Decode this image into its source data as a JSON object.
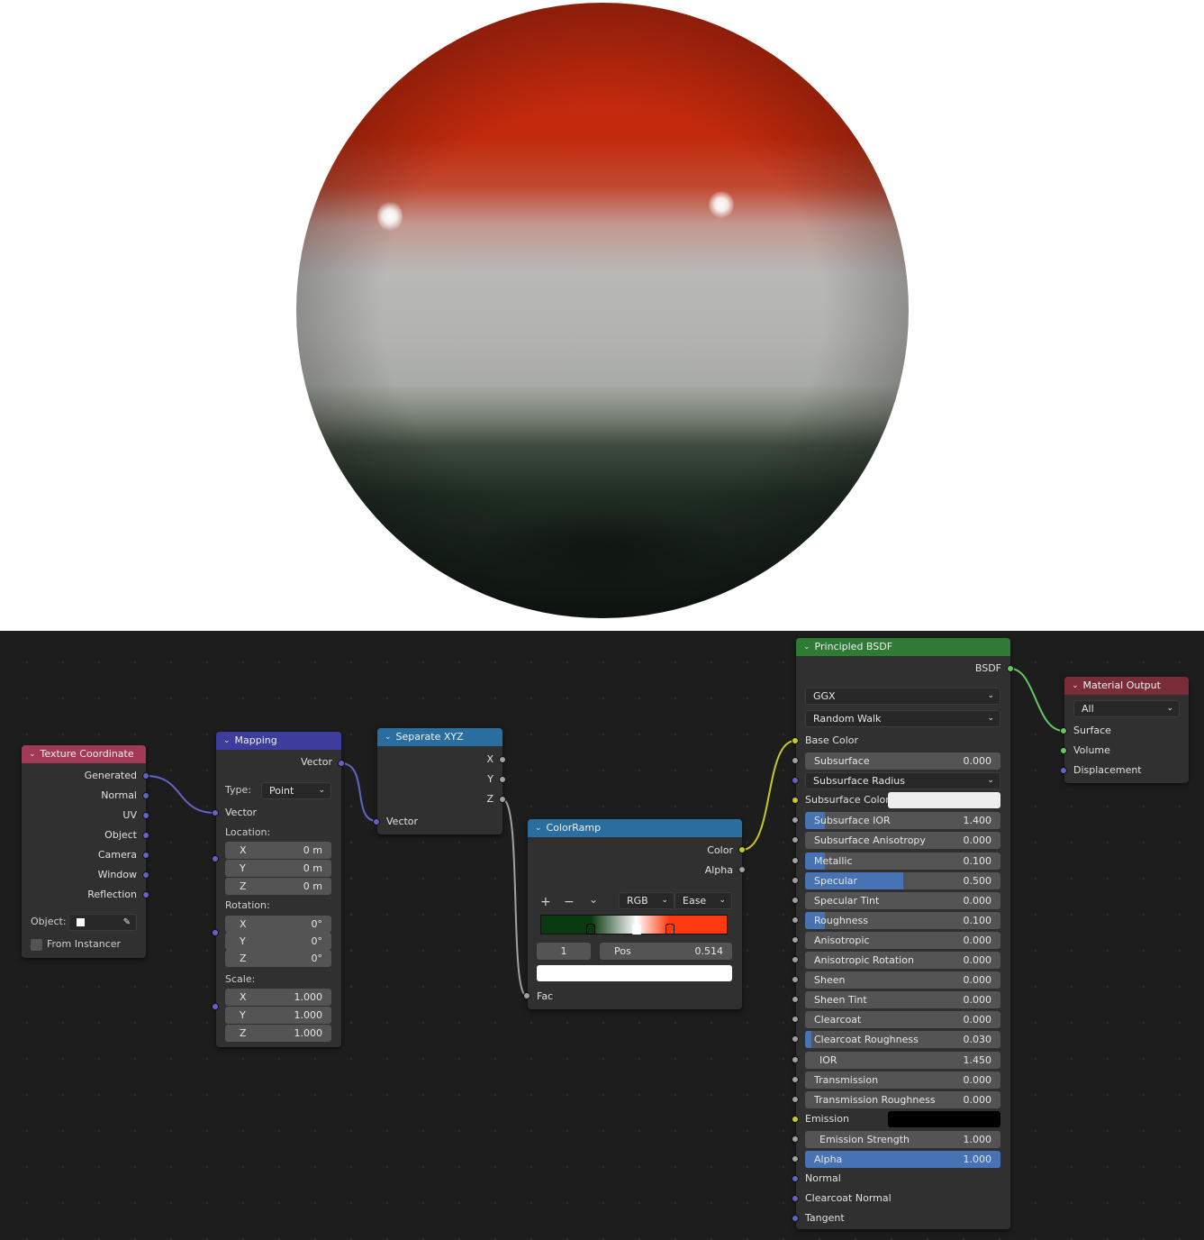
{
  "nodes": {
    "texcoord": {
      "title": "Texture Coordinate",
      "outputs": [
        "Generated",
        "Normal",
        "UV",
        "Object",
        "Camera",
        "Window",
        "Reflection"
      ],
      "object_label": "Object:",
      "from_instancer": "From Instancer",
      "header_color": "#a33a55"
    },
    "mapping": {
      "title": "Mapping",
      "output": "Vector",
      "type_label": "Type:",
      "type_value": "Point",
      "vector_label": "Vector",
      "location_label": "Location:",
      "location": [
        [
          "X",
          "0 m"
        ],
        [
          "Y",
          "0 m"
        ],
        [
          "Z",
          "0 m"
        ]
      ],
      "rotation_label": "Rotation:",
      "rotation": [
        [
          "X",
          "0°"
        ],
        [
          "Y",
          "0°"
        ],
        [
          "Z",
          "0°"
        ]
      ],
      "scale_label": "Scale:",
      "scale": [
        [
          "X",
          "1.000"
        ],
        [
          "Y",
          "1.000"
        ],
        [
          "Z",
          "1.000"
        ]
      ],
      "header_color": "#3d3d9e"
    },
    "separate": {
      "title": "Separate XYZ",
      "outputs": [
        "X",
        "Y",
        "Z"
      ],
      "input": "Vector",
      "header_color": "#2a6ea0"
    },
    "colorramp": {
      "title": "ColorRamp",
      "outputs": [
        "Color",
        "Alpha"
      ],
      "add": "+",
      "remove": "−",
      "menu": "⌄",
      "color_mode": "RGB",
      "interpolation": "Ease",
      "stop_index": "1",
      "pos_label": "Pos",
      "pos_value": "0.514",
      "input": "Fac",
      "stops": [
        0.27,
        0.514,
        0.69
      ],
      "ramp_colors": [
        "#0b3a10",
        "#ffffff",
        "#ff3a0f"
      ],
      "header_color": "#2a6ea0"
    },
    "bsdf": {
      "title": "Principled BSDF",
      "output": "BSDF",
      "distribution": "GGX",
      "subsurface_method": "Random Walk",
      "base_color": "Base Color",
      "rows": [
        {
          "label": "Subsurface",
          "value": "0.000",
          "fill": 0.0
        },
        {
          "label": "Subsurface Radius",
          "value": "",
          "fill": 0.0,
          "dropdown": true
        },
        {
          "label": "Subsurface Color",
          "value": "",
          "fill": 0.0,
          "color": true
        },
        {
          "label": "Subsurface IOR",
          "value": "1.400",
          "fill": 0.1
        },
        {
          "label": "Subsurface Anisotropy",
          "value": "0.000",
          "fill": 0.0
        },
        {
          "label": "Metallic",
          "value": "0.100",
          "fill": 0.1
        },
        {
          "label": "Specular",
          "value": "0.500",
          "fill": 0.5
        },
        {
          "label": "Specular Tint",
          "value": "0.000",
          "fill": 0.0
        },
        {
          "label": "Roughness",
          "value": "0.100",
          "fill": 0.1
        },
        {
          "label": "Anisotropic",
          "value": "0.000",
          "fill": 0.0
        },
        {
          "label": "Anisotropic Rotation",
          "value": "0.000",
          "fill": 0.0
        },
        {
          "label": "Sheen",
          "value": "0.000",
          "fill": 0.0
        },
        {
          "label": "Sheen Tint",
          "value": "0.000",
          "fill": 0.0
        },
        {
          "label": "Clearcoat",
          "value": "0.000",
          "fill": 0.0
        },
        {
          "label": "Clearcoat Roughness",
          "value": "0.030",
          "fill": 0.03
        },
        {
          "label": "IOR",
          "value": "1.450",
          "fill": 0.0
        },
        {
          "label": "Transmission",
          "value": "0.000",
          "fill": 0.0
        },
        {
          "label": "Transmission Roughness",
          "value": "0.000",
          "fill": 0.0
        },
        {
          "label": "Emission",
          "value": "",
          "fill": 0.0,
          "color": true
        },
        {
          "label": "Emission Strength",
          "value": "1.000",
          "fill": 0.0
        },
        {
          "label": "Alpha",
          "value": "1.000",
          "fill": 1.0
        },
        {
          "label": "Normal",
          "value": "",
          "fill": 0.0,
          "socket_only": true
        },
        {
          "label": "Clearcoat Normal",
          "value": "",
          "fill": 0.0,
          "socket_only": true
        },
        {
          "label": "Tangent",
          "value": "",
          "fill": 0.0,
          "socket_only": true
        }
      ],
      "subsurface_color_swatch": "#eeeeee",
      "emission_swatch": "#000000",
      "header_color": "#2f7a34"
    },
    "output": {
      "title": "Material Output",
      "target": "All",
      "inputs": [
        "Surface",
        "Volume",
        "Displacement"
      ],
      "header_color": "#7a2d38"
    }
  }
}
